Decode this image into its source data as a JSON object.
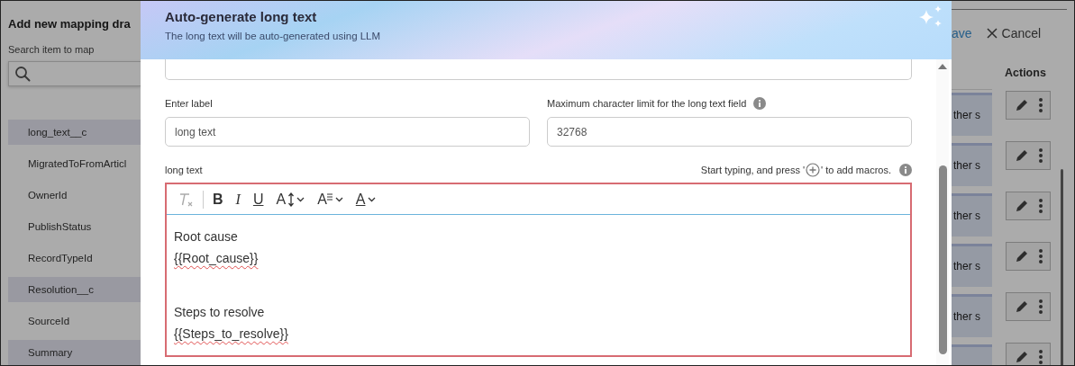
{
  "background": {
    "panel_title": "Add new mapping dra",
    "search_label": "Search item to map",
    "items": [
      {
        "label": "long_text__c",
        "selected": true
      },
      {
        "label": "MigratedToFromArticl",
        "selected": false
      },
      {
        "label": "OwnerId",
        "selected": false
      },
      {
        "label": "PublishStatus",
        "selected": false
      },
      {
        "label": "RecordTypeId",
        "selected": false
      },
      {
        "label": "Resolution__c",
        "selected": true
      },
      {
        "label": "SourceId",
        "selected": false
      },
      {
        "label": "Summary",
        "selected": true
      }
    ]
  },
  "actions_panel": {
    "save": "ave",
    "cancel": "Cancel",
    "column_header": "Actions",
    "rows": [
      {
        "cell": "ther s"
      },
      {
        "cell": "ther s"
      },
      {
        "cell": "ther s"
      },
      {
        "cell": "ther s"
      },
      {
        "cell": "ther s"
      },
      {}
    ]
  },
  "dialog": {
    "title": "Auto-generate long text",
    "subtitle": "The long text will be auto-generated using LLM",
    "fields": [
      {
        "label": "Enter label",
        "value": "long text",
        "info": false
      },
      {
        "label": "Maximum character limit for the long text field",
        "value": "32768",
        "info": true
      }
    ],
    "editor": {
      "label": "long text",
      "hint_before": "Start typing, and press '",
      "hint_after": "' to add macros.",
      "invalid": true,
      "toolbar": [
        {
          "kind": "clear",
          "disabled": true
        },
        {
          "kind": "bold",
          "glyph": "B",
          "disabled": false
        },
        {
          "kind": "italic",
          "glyph": "I",
          "disabled": false
        },
        {
          "kind": "underline",
          "glyph": "U",
          "disabled": false
        },
        {
          "kind": "size",
          "glyph": "A",
          "disabled": false
        },
        {
          "kind": "spacing",
          "glyph": "A",
          "disabled": false
        },
        {
          "kind": "color",
          "glyph": "A",
          "disabled": false
        }
      ],
      "paragraphs": [
        {
          "lines": [
            {
              "text": "Root cause",
              "kind": "text"
            },
            {
              "text": "{{Root_cause}}",
              "kind": "macro"
            }
          ]
        },
        {
          "lines": [
            {
              "text": "Steps to resolve",
              "kind": "text"
            },
            {
              "text": "{{Steps_to_resolve}}",
              "kind": "macro"
            }
          ]
        }
      ]
    }
  }
}
